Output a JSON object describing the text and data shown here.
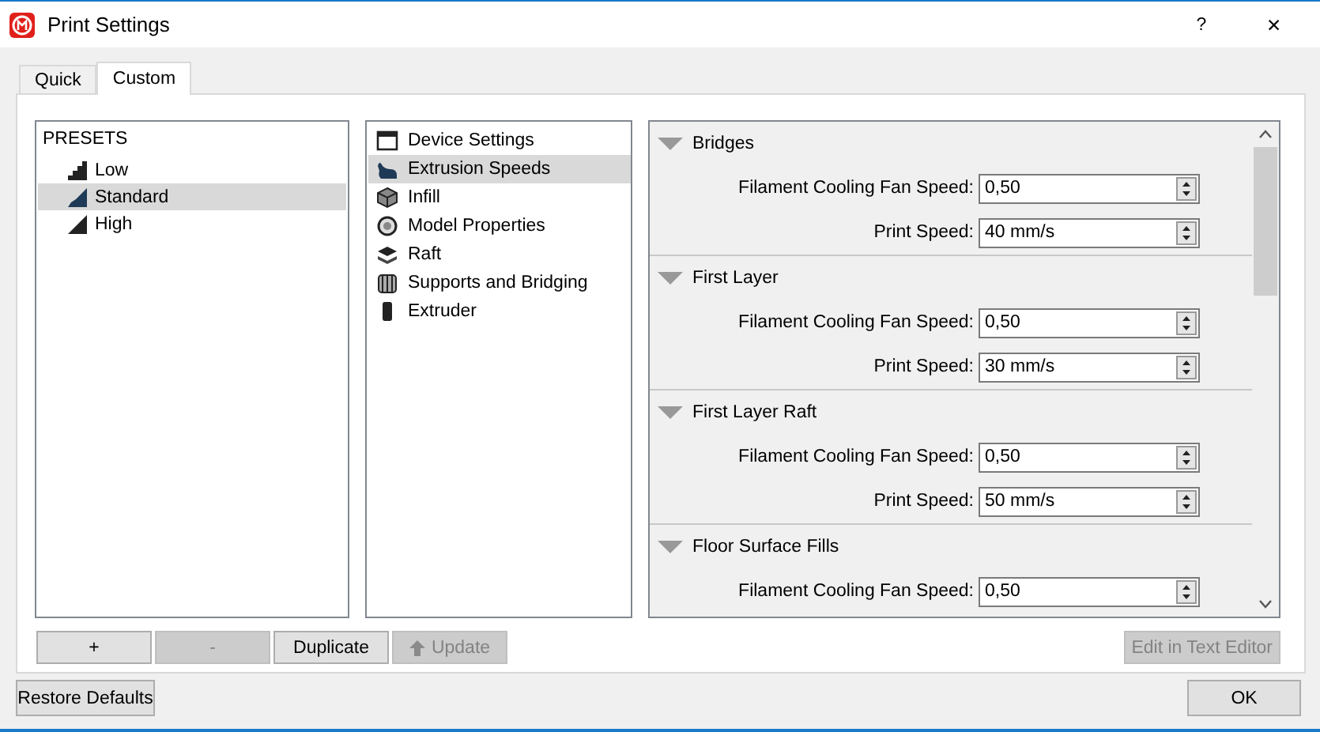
{
  "window": {
    "title": "Print Settings",
    "help": "?",
    "close": "✕"
  },
  "tabs": [
    {
      "label": "Quick",
      "selected": false
    },
    {
      "label": "Custom",
      "selected": true
    }
  ],
  "presets": {
    "heading": "PRESETS",
    "items": [
      {
        "label": "Low",
        "selected": false
      },
      {
        "label": "Standard",
        "selected": true
      },
      {
        "label": "High",
        "selected": false
      }
    ]
  },
  "categories": [
    {
      "label": "Device Settings",
      "selected": false
    },
    {
      "label": "Extrusion Speeds",
      "selected": true
    },
    {
      "label": "Infill",
      "selected": false
    },
    {
      "label": "Model Properties",
      "selected": false
    },
    {
      "label": "Raft",
      "selected": false
    },
    {
      "label": "Supports and Bridging",
      "selected": false
    },
    {
      "label": "Extruder",
      "selected": false
    }
  ],
  "sections": [
    {
      "title": "Bridges",
      "expanded": true,
      "fields": [
        {
          "label": "Filament Cooling Fan Speed:",
          "value": "0,50"
        },
        {
          "label": "Print Speed:",
          "value": "40 mm/s"
        }
      ]
    },
    {
      "title": "First Layer",
      "expanded": true,
      "fields": [
        {
          "label": "Filament Cooling Fan Speed:",
          "value": "0,50"
        },
        {
          "label": "Print Speed:",
          "value": "30 mm/s"
        }
      ]
    },
    {
      "title": "First Layer Raft",
      "expanded": true,
      "fields": [
        {
          "label": "Filament Cooling Fan Speed:",
          "value": "0,50"
        },
        {
          "label": "Print Speed:",
          "value": "50 mm/s"
        }
      ]
    },
    {
      "title": "Floor Surface Fills",
      "expanded": true,
      "fields": [
        {
          "label": "Filament Cooling Fan Speed:",
          "value": "0,50"
        }
      ]
    }
  ],
  "preset_buttons": [
    {
      "label": "+",
      "disabled": false
    },
    {
      "label": "-",
      "disabled": true
    },
    {
      "label": "Duplicate",
      "disabled": false
    },
    {
      "label": "Update",
      "disabled": true,
      "icon": true
    }
  ],
  "edit_button": {
    "label": "Edit in Text Editor",
    "disabled": true
  },
  "restore_button": {
    "label": "Restore Defaults"
  },
  "ok_button": {
    "label": "OK"
  }
}
